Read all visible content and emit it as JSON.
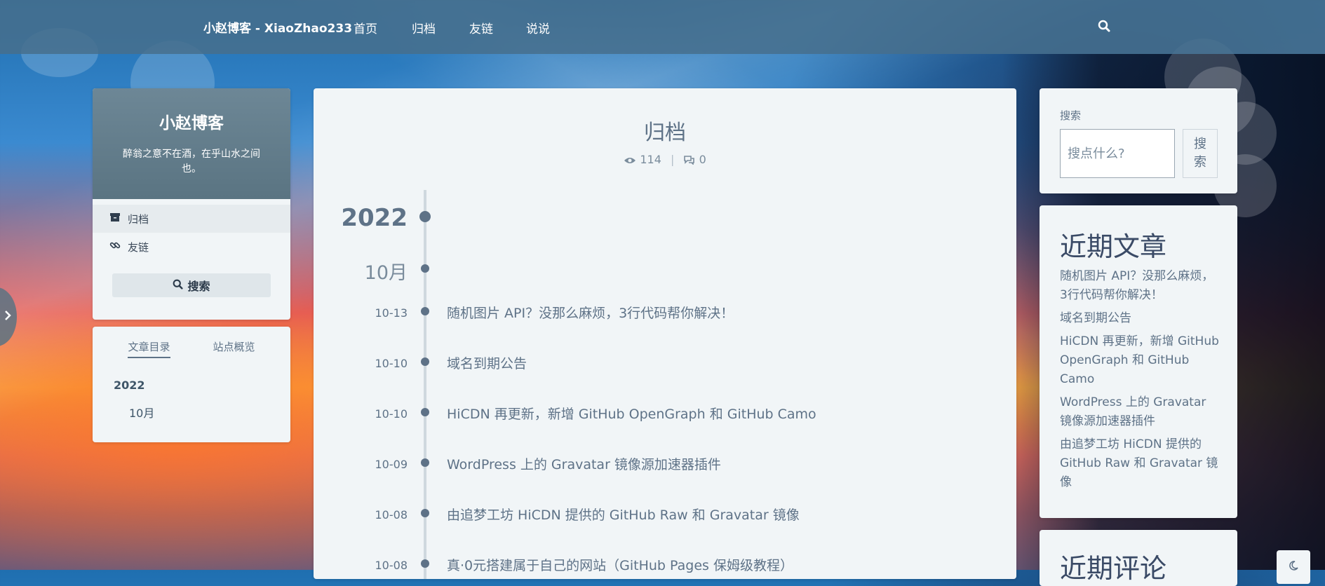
{
  "nav": {
    "brand": "小赵博客 - XiaoZhao233",
    "links": [
      "首页",
      "归档",
      "友链",
      "说说"
    ],
    "search_icon": "search-icon"
  },
  "profile": {
    "name": "小赵博客",
    "motto": "醉翁之意不在酒，在乎山水之间也。",
    "menu": [
      {
        "label": "归档",
        "icon": "archive-icon"
      },
      {
        "label": "友链",
        "icon": "link-icon"
      }
    ],
    "search_label": "搜索"
  },
  "toc": {
    "tabs": [
      "文章目录",
      "站点概览"
    ],
    "year": "2022",
    "month": "10月"
  },
  "main": {
    "title": "归档",
    "views": "114",
    "separator": "|",
    "comments": "0",
    "year": "2022",
    "month": "10月",
    "posts": [
      {
        "date": "10-13",
        "title": "随机图片 API？没那么麻烦，3行代码帮你解决！"
      },
      {
        "date": "10-10",
        "title": "域名到期公告"
      },
      {
        "date": "10-10",
        "title": "HiCDN 再更新，新增 GitHub OpenGraph 和 GitHub Camo"
      },
      {
        "date": "10-09",
        "title": "WordPress 上的 Gravatar 镜像源加速器插件"
      },
      {
        "date": "10-08",
        "title": "由追梦工坊 HiCDN 提供的 GitHub Raw 和 Gravatar 镜像"
      },
      {
        "date": "10-08",
        "title": "真·0元搭建属于自己的网站（GitHub Pages 保姆级教程）"
      }
    ]
  },
  "sidebar": {
    "search_label": "搜索",
    "search_placeholder": "搜点什么?",
    "search_button": "搜索",
    "recent_title": "近期文章",
    "recent": [
      "随机图片 API？没那么麻烦，3行代码帮你解决！",
      "域名到期公告",
      "HiCDN 再更新，新增 GitHub OpenGraph 和 GitHub Camo",
      "WordPress 上的 Gravatar 镜像源加速器插件",
      "由追梦工坊 HiCDN 提供的 GitHub Raw 和 Gravatar 镜像"
    ],
    "comments_title": "近期评论"
  },
  "colors": {
    "accent": "#5e7287",
    "card": "#f1f5f7",
    "navbar": "#466e8c"
  }
}
